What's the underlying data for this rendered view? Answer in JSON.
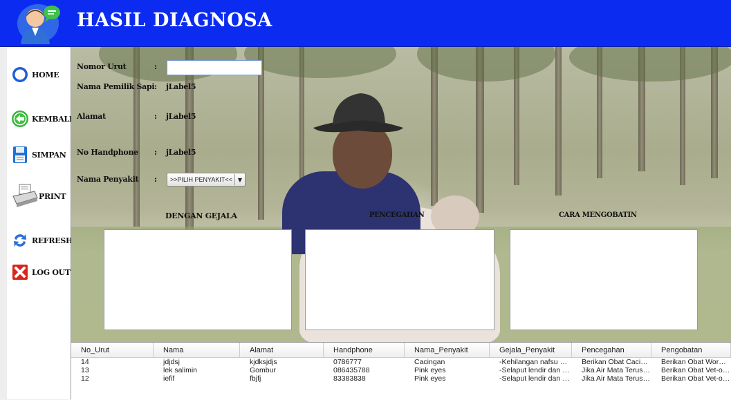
{
  "header": {
    "title": "HASIL DIAGNOSA"
  },
  "sidebar": {
    "items": [
      {
        "label": "HOME",
        "icon": "home-icon"
      },
      {
        "label": "KEMBALI",
        "icon": "back-arrow-icon"
      },
      {
        "label": "SIMPAN",
        "icon": "save-icon"
      },
      {
        "label": "PRINT",
        "icon": "printer-icon"
      },
      {
        "label": "REFRESH",
        "icon": "refresh-icon"
      },
      {
        "label": "LOG OUT",
        "icon": "logout-icon"
      }
    ]
  },
  "form": {
    "nomor_urut_label": "Nomor Urut",
    "nomor_urut_value": "",
    "nama_pemilik_label": "Nama Pemilik Sapi",
    "nama_pemilik_value": "jLabel5",
    "alamat_label": "Alamat",
    "alamat_value": "jLabel5",
    "handphone_label": "No Handphone",
    "handphone_value": "jLabel5",
    "penyakit_label": "Nama Penyakit",
    "penyakit_selected": ">>PILIH PENYAKIT<<",
    "colon": ":"
  },
  "sections": {
    "gejala": "DENGAN GEJALA",
    "pencegahan": "PENCEGAHAN",
    "cara": "CARA MENGOBATIN"
  },
  "table": {
    "columns": [
      "No_Urut",
      "Nama",
      "Alamat",
      "Handphone",
      "Nama_Penyakit",
      "Gejala_Penyakit",
      "Pencegahan",
      "Pengobatan"
    ],
    "rows": [
      [
        "14",
        "jdjdsj",
        "kjdksjdjs",
        "0786777",
        "Cacingan",
        "-Kehilangan nafsu maka...",
        "Berikan Obat Cacing Pa...",
        "Berikan Obat Wormzol-"
      ],
      [
        "13",
        "lek salimin",
        "Gombur",
        "086435788",
        "Pink eyes",
        "-Selaput lendir dan katu...",
        "Jika Air Mata Terus men...",
        "Berikan Obat Vet-oxyda"
      ],
      [
        "12",
        "iefif",
        "fbjfj",
        "83383838",
        "Pink eyes",
        "-Selaput lendir dan katu...",
        "Jika Air Mata Terus men...",
        "Berikan Obat Vet-oxyda"
      ]
    ]
  },
  "colors": {
    "header_bg": "#0b2cf0",
    "title_text": "#ffffff"
  }
}
